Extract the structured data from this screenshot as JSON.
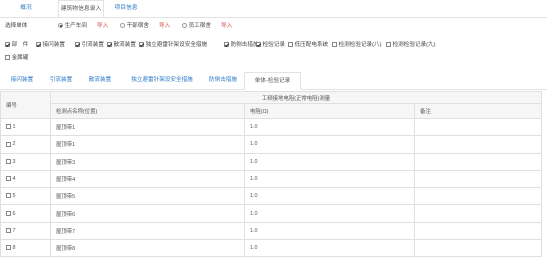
{
  "top_tabs": [
    {
      "label": "概况"
    },
    {
      "label": "建筑物信息录入"
    },
    {
      "label": "项目信息"
    }
  ],
  "select": {
    "label": "选择单体",
    "options": [
      {
        "label": "生产车间",
        "checked": true,
        "action": "导入"
      },
      {
        "label": "干部宿舍",
        "checked": false,
        "action": "导入"
      },
      {
        "label": "员工宿舍",
        "checked": false,
        "action": "导入"
      }
    ]
  },
  "parts": {
    "label": "部　件",
    "items": [
      {
        "label": "接闪装置",
        "checked": true
      },
      {
        "label": "引流装置",
        "checked": true
      },
      {
        "label": "散流装置",
        "checked": true
      },
      {
        "label": "独立避雷针架设安全措施",
        "checked": true
      },
      {
        "label": "防侧击措施",
        "checked": true
      },
      {
        "label": "检验记录",
        "checked": true
      },
      {
        "label": "低压配电系统",
        "checked": false
      },
      {
        "label": "检测检验记录(八)",
        "checked": false
      },
      {
        "label": "检测检验记录(九)",
        "checked": false
      },
      {
        "label": "金属罐",
        "checked": false
      }
    ]
  },
  "sub_tabs": [
    {
      "label": "接闪装置"
    },
    {
      "label": "引流装置"
    },
    {
      "label": "散流装置"
    },
    {
      "label": "独立避雷针架设安全措施"
    },
    {
      "label": "防侧击措施"
    },
    {
      "label": "单体-检验记录"
    }
  ],
  "table": {
    "col_no": "编号",
    "group_header": "工频接地电阻(正常电阻)测量",
    "col_location": "检测点名称(位置)",
    "col_resistance": "电阻(Ω)",
    "col_remark": "备注",
    "rows": [
      {
        "no": "1",
        "location": "屋顶带1",
        "resistance": "1.0",
        "remark": ""
      },
      {
        "no": "2",
        "location": "屋顶带1",
        "resistance": "1.0",
        "remark": ""
      },
      {
        "no": "3",
        "location": "屋顶带3",
        "resistance": "1.0",
        "remark": ""
      },
      {
        "no": "4",
        "location": "屋顶带4",
        "resistance": "1.0",
        "remark": ""
      },
      {
        "no": "5",
        "location": "屋顶带5",
        "resistance": "1.0",
        "remark": ""
      },
      {
        "no": "6",
        "location": "屋顶带6",
        "resistance": "1.0",
        "remark": ""
      },
      {
        "no": "7",
        "location": "屋顶带7",
        "resistance": "1.0",
        "remark": ""
      },
      {
        "no": "8",
        "location": "屋顶带8",
        "resistance": "1.0",
        "remark": ""
      }
    ]
  }
}
